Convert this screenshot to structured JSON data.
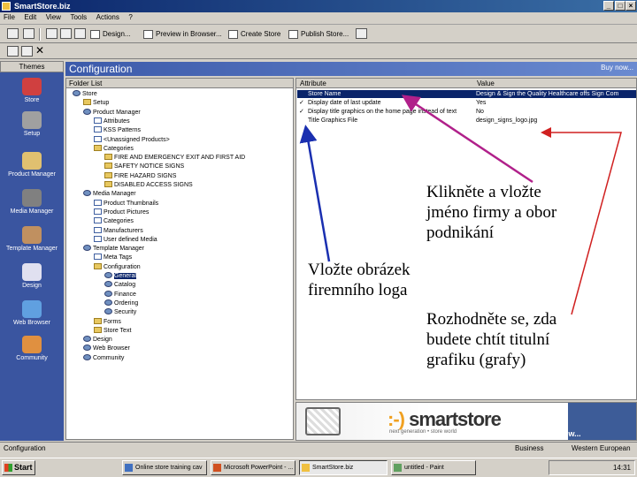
{
  "window": {
    "title": "SmartStore.biz",
    "minimize": "_",
    "maximize": "□",
    "close": "×"
  },
  "menu": [
    "File",
    "Edit",
    "View",
    "Tools",
    "Actions",
    "?"
  ],
  "toolbar": {
    "buttons": [
      {
        "label": "Design...",
        "icon": "design-icon"
      },
      {
        "label": "Preview in Browser...",
        "icon": "browser-preview-icon"
      },
      {
        "label": "Create Store",
        "icon": "create-store-icon"
      },
      {
        "label": "Publish Store...",
        "icon": "publish-icon"
      }
    ]
  },
  "themes": {
    "title": "Themes",
    "items": [
      {
        "label": "Store",
        "color": "#d04040"
      },
      {
        "label": "Setup",
        "color": "#a0a0a0"
      },
      {
        "label": "Product Manager",
        "color": "#e0c070"
      },
      {
        "label": "Media Manager",
        "color": "#808080"
      },
      {
        "label": "Template Manager",
        "color": "#c09060"
      },
      {
        "label": "Design",
        "color": "#e0e0f0"
      },
      {
        "label": "Web Browser",
        "color": "#60a0e0"
      },
      {
        "label": "Community",
        "color": "#e09040"
      }
    ]
  },
  "config": {
    "title": "Configuration",
    "buy_now": "Buy now..."
  },
  "folder_list": {
    "header": "Folder List",
    "items": [
      {
        "label": "Store",
        "indent": 0,
        "type": "gear"
      },
      {
        "label": "Setup",
        "indent": 1,
        "type": "folder"
      },
      {
        "label": "Product Manager",
        "indent": 1,
        "type": "gear"
      },
      {
        "label": "Attributes",
        "indent": 2,
        "type": "doc"
      },
      {
        "label": "KSS Patterns",
        "indent": 2,
        "type": "doc"
      },
      {
        "label": "<Unassigned Products>",
        "indent": 2,
        "type": "doc"
      },
      {
        "label": "Categories",
        "indent": 2,
        "type": "folder"
      },
      {
        "label": "FIRE AND EMERGENCY EXIT AND FIRST AID",
        "indent": 3,
        "type": "folder"
      },
      {
        "label": "SAFETY NOTICE SIGNS",
        "indent": 3,
        "type": "folder"
      },
      {
        "label": "FIRE HAZARD SIGNS",
        "indent": 3,
        "type": "folder"
      },
      {
        "label": "DISABLED ACCESS SIGNS",
        "indent": 3,
        "type": "folder"
      },
      {
        "label": "Media Manager",
        "indent": 1,
        "type": "gear"
      },
      {
        "label": "Product Thumbnails",
        "indent": 2,
        "type": "doc"
      },
      {
        "label": "Product Pictures",
        "indent": 2,
        "type": "doc"
      },
      {
        "label": "Categories",
        "indent": 2,
        "type": "doc"
      },
      {
        "label": "Manufacturers",
        "indent": 2,
        "type": "doc"
      },
      {
        "label": "User defined Media",
        "indent": 2,
        "type": "doc"
      },
      {
        "label": "Template Manager",
        "indent": 1,
        "type": "gear"
      },
      {
        "label": "Meta Tags",
        "indent": 2,
        "type": "doc"
      },
      {
        "label": "Configuration",
        "indent": 2,
        "type": "folder"
      },
      {
        "label": "General",
        "indent": 3,
        "type": "gear",
        "selected": true
      },
      {
        "label": "Catalog",
        "indent": 3,
        "type": "gear"
      },
      {
        "label": "Finance",
        "indent": 3,
        "type": "gear"
      },
      {
        "label": "Ordering",
        "indent": 3,
        "type": "gear"
      },
      {
        "label": "Security",
        "indent": 3,
        "type": "gear"
      },
      {
        "label": "Forms",
        "indent": 2,
        "type": "folder"
      },
      {
        "label": "Store Text",
        "indent": 2,
        "type": "folder"
      },
      {
        "label": "Design",
        "indent": 1,
        "type": "gear"
      },
      {
        "label": "Web Browser",
        "indent": 1,
        "type": "gear"
      },
      {
        "label": "Community",
        "indent": 1,
        "type": "gear"
      }
    ]
  },
  "attributes": {
    "col_attribute": "Attribute",
    "col_value": "Value",
    "rows": [
      {
        "check": "",
        "attribute": "Store Name",
        "value": "Design & Sign the Quality Healthcare offs Sign Com",
        "selected": true
      },
      {
        "check": "✓",
        "attribute": "Display date of last update",
        "value": "Yes"
      },
      {
        "check": "✓",
        "attribute": "Display title graphics on the home page instead of text",
        "value": "No"
      },
      {
        "check": "",
        "attribute": "Title Graphics File",
        "value": "design_signs_logo.jpg"
      }
    ]
  },
  "banner": {
    "logo": "smartstore",
    "tagline": "next generation • store world",
    "buy_now": "Buy now..."
  },
  "status": {
    "left": "Configuration",
    "right1": "Business",
    "right2": "Western European"
  },
  "taskbar": {
    "start": "Start",
    "tasks": [
      {
        "label": "Online store training cav",
        "active": false
      },
      {
        "label": "Microsoft PowerPoint - ...",
        "active": false
      },
      {
        "label": "SmartStore.biz",
        "active": true
      },
      {
        "label": "untitled - Paint",
        "active": false
      }
    ],
    "clock": "14:31"
  },
  "annotations": {
    "company": [
      "Klikněte a vložte",
      "jméno firmy a obor",
      "podnikání"
    ],
    "logo": [
      "Vložte obrázek",
      "firemního loga"
    ],
    "graphics": [
      "Rozhodněte se, zda",
      "budete chtít titulní",
      "grafiku (grafy)"
    ]
  }
}
